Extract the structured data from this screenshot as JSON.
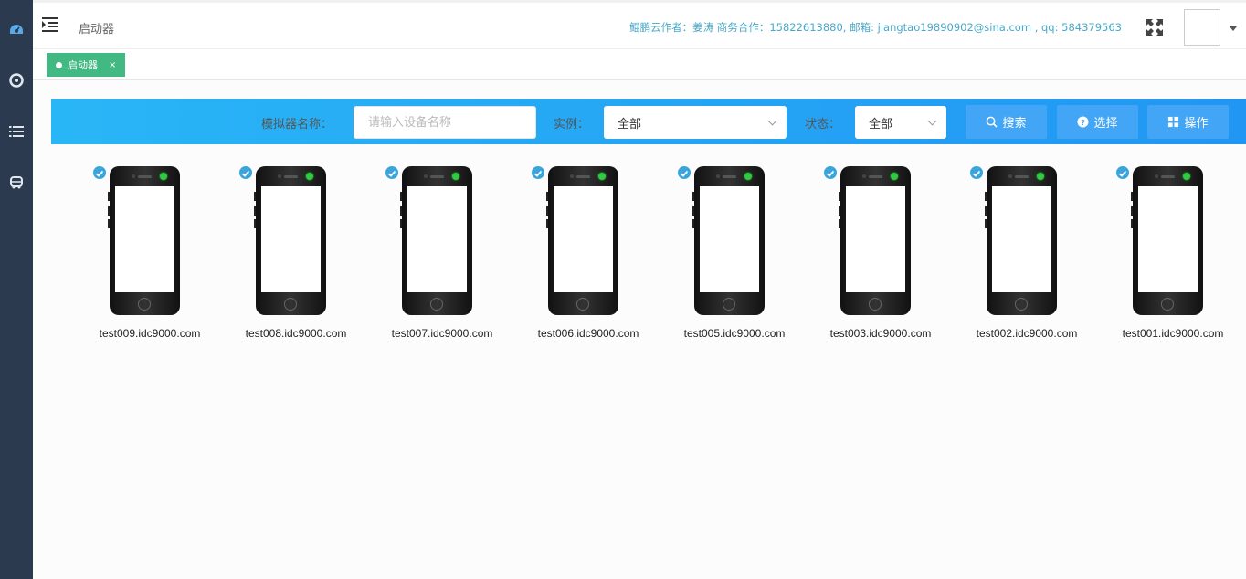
{
  "sidebar": {
    "items": [
      {
        "icon": "dashboard-icon"
      },
      {
        "icon": "target-icon"
      },
      {
        "icon": "list-icon"
      },
      {
        "icon": "bus-icon"
      }
    ]
  },
  "header": {
    "title": "启动器",
    "author_info": "鲲鹏云作者：姜涛 商务合作：15822613880, 邮箱: jiangtao19890902@sina.com , qq: 584379563"
  },
  "tabs": [
    {
      "label": "启动器",
      "close": "×"
    }
  ],
  "filter": {
    "name_label": "模拟器名称：",
    "name_placeholder": "请输入设备名称",
    "instance_label": "实例：",
    "instance_value": "全部",
    "status_label": "状态：",
    "status_value": "全部",
    "search_label": "搜索",
    "select_label": "选择",
    "operate_label": "操作"
  },
  "devices": [
    {
      "name": "test009.idc9000.com",
      "checked": true,
      "online": true
    },
    {
      "name": "test008.idc9000.com",
      "checked": true,
      "online": true
    },
    {
      "name": "test007.idc9000.com",
      "checked": true,
      "online": true
    },
    {
      "name": "test006.idc9000.com",
      "checked": true,
      "online": true
    },
    {
      "name": "test005.idc9000.com",
      "checked": true,
      "online": true
    },
    {
      "name": "test003.idc9000.com",
      "checked": true,
      "online": true
    },
    {
      "name": "test002.idc9000.com",
      "checked": true,
      "online": true
    },
    {
      "name": "test001.idc9000.com",
      "checked": true,
      "online": true
    }
  ],
  "colors": {
    "sidebar": "#2b3a4f",
    "tab_active": "#42b983",
    "filter_gradient_start": "#29b6f6",
    "filter_gradient_end": "#2196f3",
    "button": "#42a5f5",
    "online_led": "#2ecc40",
    "check": "#3aa4dc"
  }
}
